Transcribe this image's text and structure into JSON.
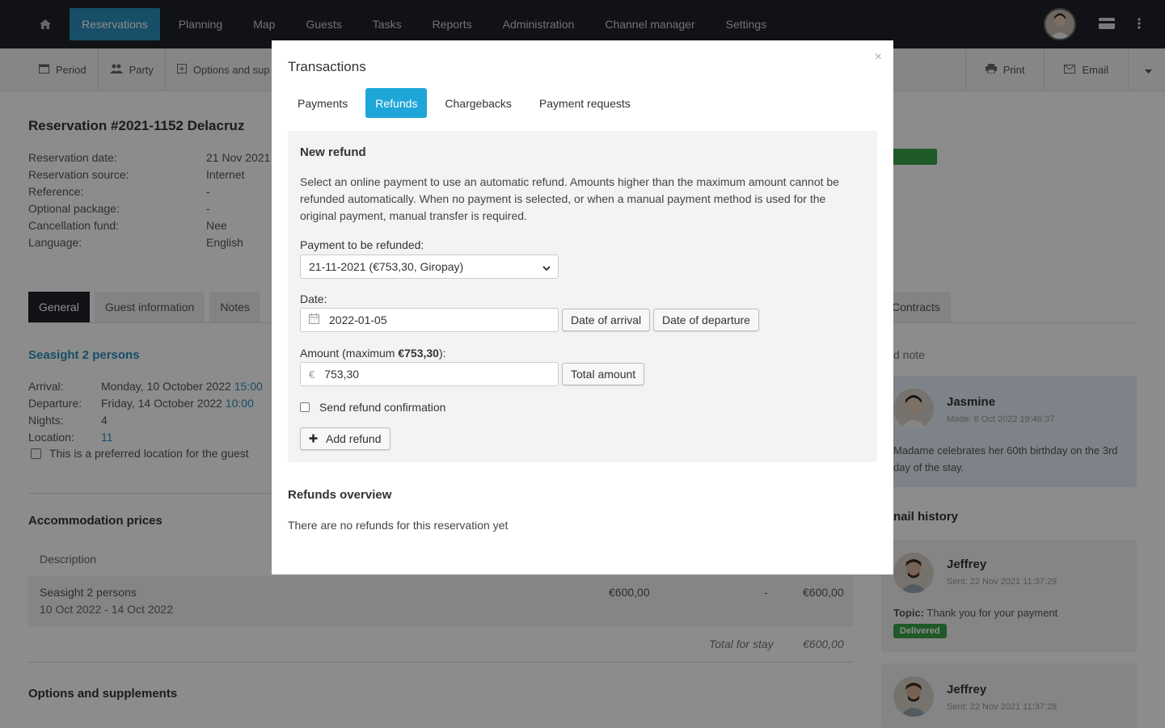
{
  "nav": {
    "items": [
      "Reservations",
      "Planning",
      "Map",
      "Guests",
      "Tasks",
      "Reports",
      "Administration",
      "Channel manager",
      "Settings"
    ]
  },
  "toolbar": {
    "period": "Period",
    "party": "Party",
    "options": "Options and sup",
    "print": "Print",
    "email": "Email"
  },
  "reservation": {
    "title": "Reservation #2021-1152 Delacruz",
    "meta": [
      {
        "k": "Reservation date:",
        "v": "21 Nov 2021"
      },
      {
        "k": "Reservation source:",
        "v": "Internet"
      },
      {
        "k": "Reference:",
        "v": "-"
      },
      {
        "k": "Optional package:",
        "v": "-"
      },
      {
        "k": "Cancellation fund:",
        "v": "Nee"
      },
      {
        "k": "Language:",
        "v": "English"
      }
    ]
  },
  "page_tabs": [
    "General",
    "Guest information",
    "Notes"
  ],
  "page_tab_right": "Contracts",
  "stay": {
    "title": "Seasight 2 persons",
    "arrival_k": "Arrival:",
    "arrival_v": "Monday, 10 October 2022",
    "arrival_t": "15:00",
    "departure_k": "Departure:",
    "departure_v": "Friday, 14 October 2022",
    "departure_t": "10:00",
    "nights_k": "Nights:",
    "nights_v": "4",
    "location_k": "Location:",
    "location_v": "11",
    "preferred": "This is a preferred location for the guest"
  },
  "accommodation": {
    "title": "Accommodation prices",
    "desc_head": "Description",
    "row_title": "Seasight 2 persons",
    "row_dates": "10 Oct 2022 - 14 Oct 2022",
    "price": "€600,00",
    "discount": "-",
    "total": "€600,00",
    "total_label": "Total for stay",
    "total_value": "€600,00"
  },
  "options_title": "Options and supplements",
  "right": {
    "notes_label": "d note",
    "note": {
      "name": "Jasmine",
      "made": "Made: 8 Oct 2022 19:46:37",
      "text": "Madame celebrates her 60th birthday on the 3rd day of the stay."
    },
    "email_history": "nail history",
    "mail1": {
      "name": "Jeffrey",
      "sent": "Sent: 22 Nov 2021 11:37:29",
      "topic_k": "Topic:",
      "topic_v": "Thank you for your payment",
      "badge": "Delivered"
    },
    "mail2": {
      "name": "Jeffrey",
      "sent": "Sent: 22 Nov 2021 11:37:28"
    }
  },
  "modal": {
    "title": "Transactions",
    "close": "×",
    "tabs": [
      "Payments",
      "Refunds",
      "Chargebacks",
      "Payment requests"
    ],
    "panel_title": "New refund",
    "help": "Select an online payment to use an automatic refund. Amounts higher than the maximum amount cannot be refunded automatically. When no payment is selected, or when a manual payment method is used for the original payment, manual transfer is required.",
    "payment_label": "Payment to be refunded:",
    "payment_value": "21-11-2021 (€753,30, Giropay)",
    "date_label": "Date:",
    "date_value": "2022-01-05",
    "date_arrival_btn": "Date of arrival",
    "date_departure_btn": "Date of departure",
    "amount_label_pre": "Amount (maximum ",
    "amount_label_max": "€753,30",
    "amount_label_post": "):",
    "currency": "€",
    "amount_value": "753,30",
    "total_amount_btn": "Total amount",
    "send_confirmation": "Send refund confirmation",
    "add_refund": "Add refund",
    "overview_title": "Refunds overview",
    "overview_text": "There are no refunds for this reservation yet"
  }
}
